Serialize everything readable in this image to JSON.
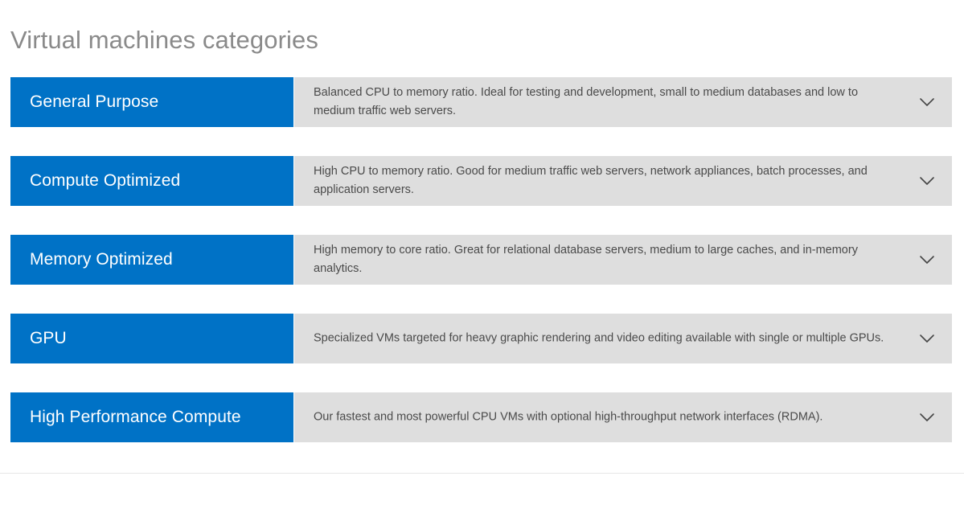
{
  "page": {
    "title": "Virtual machines categories",
    "accent_color": "#0072C6",
    "panel_color": "#dedede",
    "title_color": "#8a8a8a",
    "desc_color": "#4a4a4a"
  },
  "accordion": {
    "chevron_icon": "chevron-down-icon",
    "items": [
      {
        "label": "General Purpose",
        "description": "Balanced CPU to memory ratio. Ideal for testing and development, small to medium databases and low to medium traffic web servers.",
        "expanded": false
      },
      {
        "label": "Compute Optimized",
        "description": "High CPU to memory ratio. Good for medium traffic web servers, network appliances, batch processes, and application servers.",
        "expanded": false
      },
      {
        "label": "Memory Optimized",
        "description": "High memory to core ratio. Great for relational database servers, medium to large caches, and in-memory analytics.",
        "expanded": false
      },
      {
        "label": "GPU",
        "description": "Specialized VMs targeted for heavy graphic rendering and video editing available with single or multiple GPUs.",
        "expanded": false
      },
      {
        "label": "High Performance Compute",
        "description": "Our fastest and most powerful CPU VMs with optional high-throughput network interfaces (RDMA).",
        "expanded": false
      }
    ]
  }
}
